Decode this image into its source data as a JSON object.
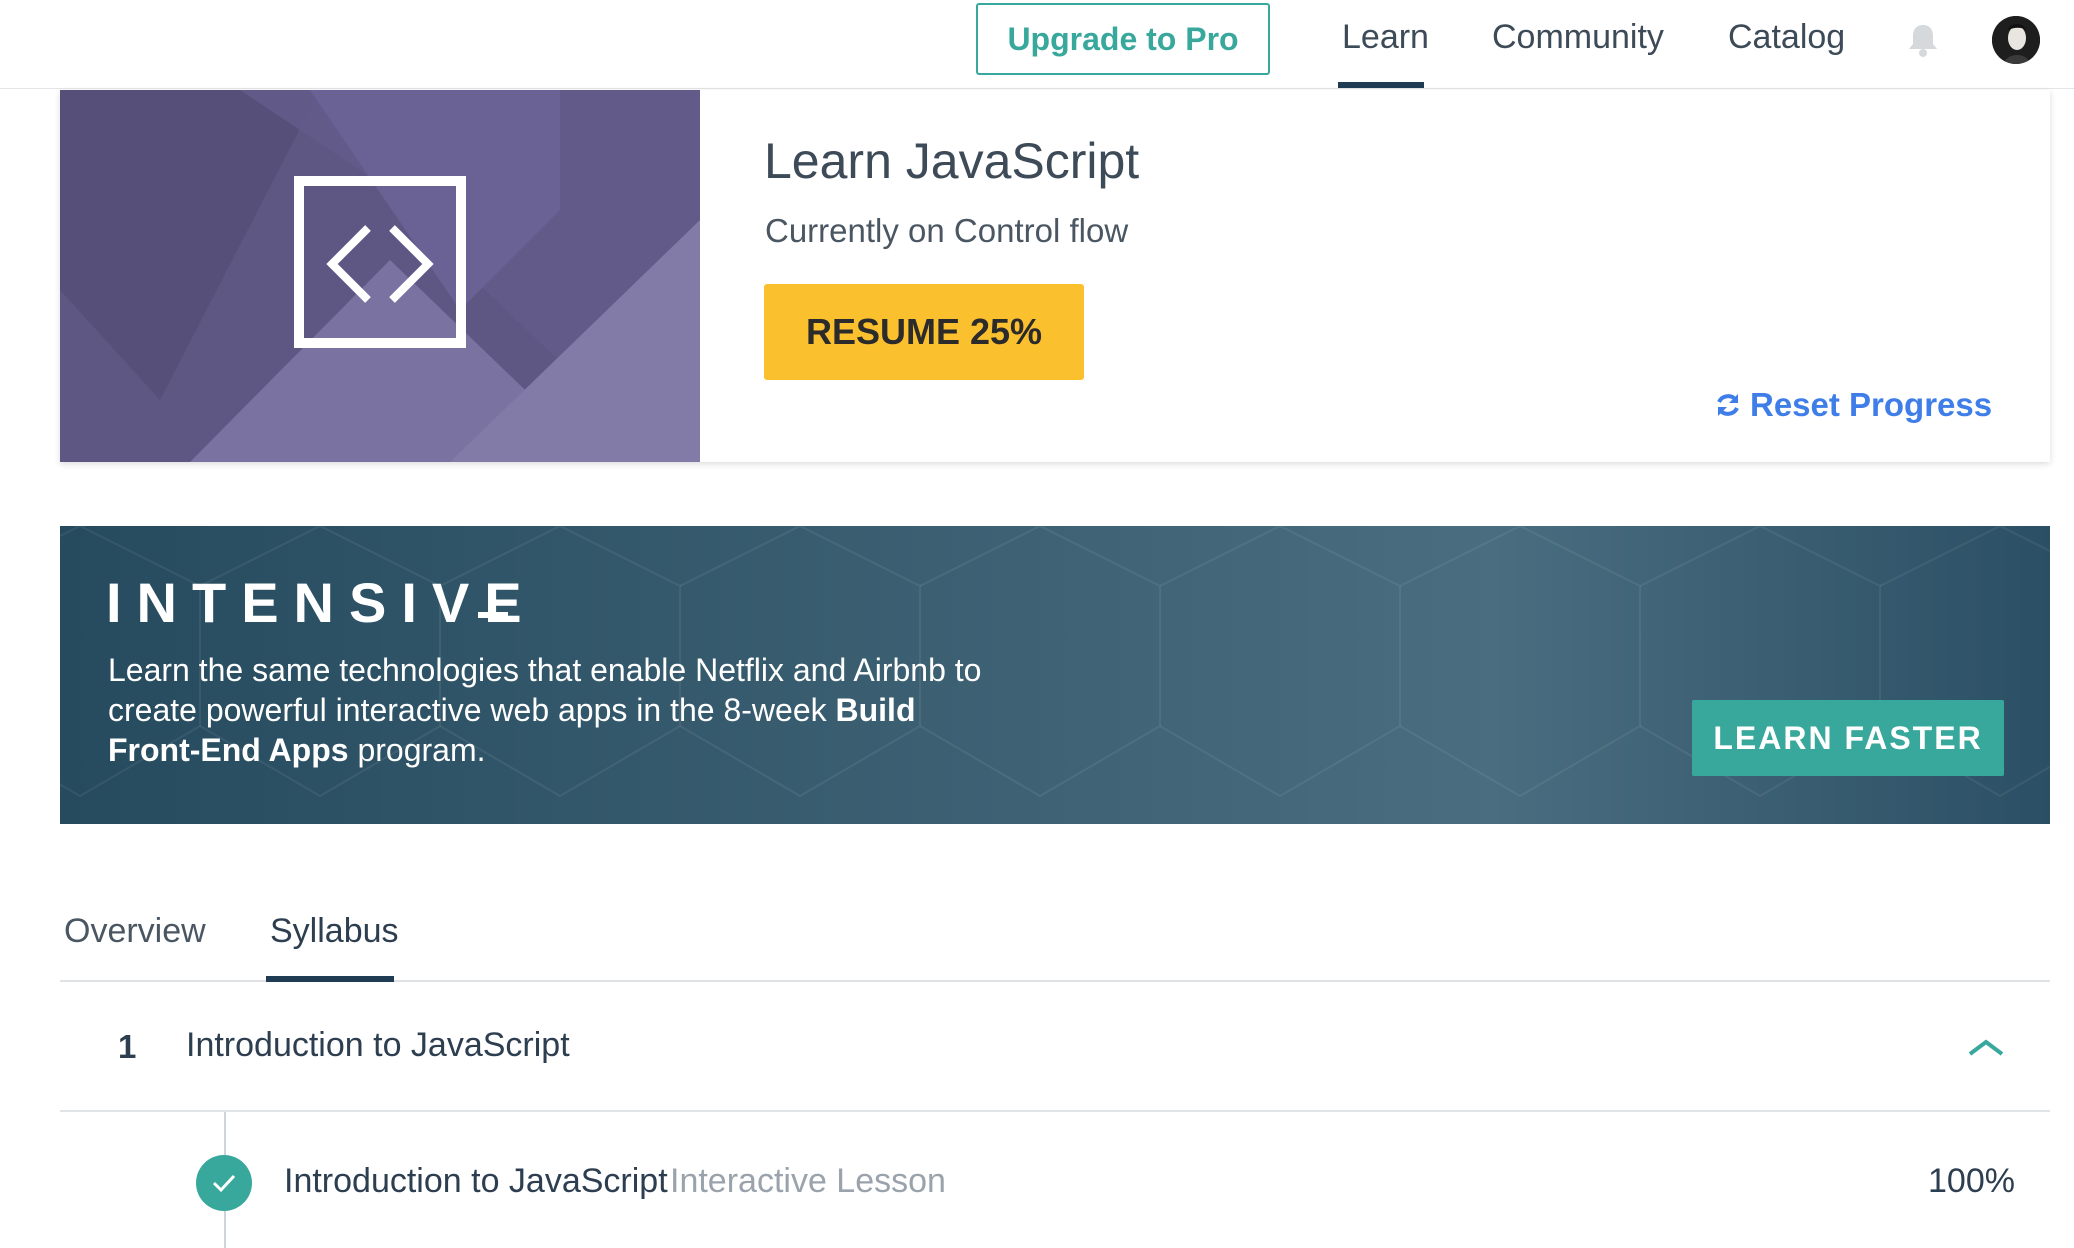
{
  "nav": {
    "upgrade_label": "Upgrade to Pro",
    "links": [
      "Learn",
      "Community",
      "Catalog"
    ],
    "active_link": "Learn",
    "icons": {
      "notifications": "bell-icon",
      "avatar": "user-avatar"
    }
  },
  "course": {
    "title": "Learn JavaScript",
    "subtitle": "Currently on Control flow",
    "resume_label": "RESUME 25%",
    "progress_percent": 25,
    "reset_label": "Reset Progress",
    "image_icon": "code-brackets-icon"
  },
  "banner": {
    "title": "INTENSIVE",
    "text_1": "Learn the same technologies that enable Netflix and Airbnb to create powerful interactive web apps in the 8-week ",
    "text_bold": "Build Front-End Apps",
    "text_2": " program.",
    "button_label": "LEARN FASTER"
  },
  "tabs": [
    "Overview",
    "Syllabus"
  ],
  "active_tab": "Syllabus",
  "syllabus": {
    "units": [
      {
        "number": "1",
        "title": "Introduction to JavaScript",
        "expanded": true,
        "lessons": [
          {
            "title": "Introduction to JavaScript",
            "type": "Interactive Lesson",
            "progress": "100%",
            "complete": true
          }
        ]
      }
    ]
  },
  "colors": {
    "accent": "#38a89d",
    "resume": "#fbc02d",
    "link": "#3f7ee8",
    "nav_active": "#203c54",
    "course_image": "#625a8a",
    "banner": "#3f6375"
  }
}
